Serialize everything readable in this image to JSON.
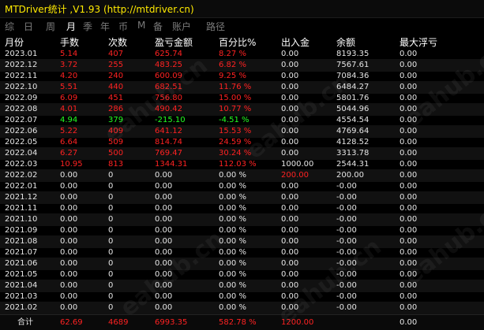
{
  "title": "MTDriver统计 ,V1.93 (http://mtdriver.cn)",
  "tabs": [
    {
      "label": "综",
      "active": false
    },
    {
      "label": "日",
      "active": false
    },
    {
      "label": "周",
      "active": false
    },
    {
      "label": "月",
      "active": true
    },
    {
      "label": "季",
      "active": false
    },
    {
      "label": "年",
      "active": false
    },
    {
      "label": "币",
      "active": false
    },
    {
      "label": "M",
      "active": false
    },
    {
      "label": "备",
      "active": false
    },
    {
      "label": "账户",
      "active": false
    },
    {
      "label": "路径",
      "active": false
    }
  ],
  "headers": [
    "月份",
    "手数",
    "次数",
    "盈亏金额",
    "百分比%",
    "出入金",
    "余额",
    "最大浮亏"
  ],
  "rows": [
    {
      "month": "2023.01",
      "lots": "5.14",
      "orders": "407",
      "profit": "625.74",
      "pct": "8.27 %",
      "dep": "0.00",
      "bal": "8193.35",
      "dd": "0.00",
      "color": "red"
    },
    {
      "month": "2022.12",
      "lots": "3.72",
      "orders": "255",
      "profit": "483.25",
      "pct": "6.82 %",
      "dep": "0.00",
      "bal": "7567.61",
      "dd": "0.00",
      "color": "red"
    },
    {
      "month": "2022.11",
      "lots": "4.20",
      "orders": "240",
      "profit": "600.09",
      "pct": "9.25 %",
      "dep": "0.00",
      "bal": "7084.36",
      "dd": "0.00",
      "color": "red"
    },
    {
      "month": "2022.10",
      "lots": "5.51",
      "orders": "440",
      "profit": "682.51",
      "pct": "11.76 %",
      "dep": "0.00",
      "bal": "6484.27",
      "dd": "0.00",
      "color": "red"
    },
    {
      "month": "2022.09",
      "lots": "6.09",
      "orders": "451",
      "profit": "756.80",
      "pct": "15.00 %",
      "dep": "0.00",
      "bal": "5801.76",
      "dd": "0.00",
      "color": "red"
    },
    {
      "month": "2022.08",
      "lots": "4.01",
      "orders": "286",
      "profit": "490.42",
      "pct": "10.77 %",
      "dep": "0.00",
      "bal": "5044.96",
      "dd": "0.00",
      "color": "red"
    },
    {
      "month": "2022.07",
      "lots": "4.94",
      "orders": "379",
      "profit": "-215.10",
      "pct": "-4.51 %",
      "dep": "0.00",
      "bal": "4554.54",
      "dd": "0.00",
      "color": "green"
    },
    {
      "month": "2022.06",
      "lots": "5.22",
      "orders": "409",
      "profit": "641.12",
      "pct": "15.53 %",
      "dep": "0.00",
      "bal": "4769.64",
      "dd": "0.00",
      "color": "red"
    },
    {
      "month": "2022.05",
      "lots": "6.64",
      "orders": "509",
      "profit": "814.74",
      "pct": "24.59 %",
      "dep": "0.00",
      "bal": "4128.52",
      "dd": "0.00",
      "color": "red"
    },
    {
      "month": "2022.04",
      "lots": "6.27",
      "orders": "500",
      "profit": "769.47",
      "pct": "30.24 %",
      "dep": "0.00",
      "bal": "3313.78",
      "dd": "0.00",
      "color": "red"
    },
    {
      "month": "2022.03",
      "lots": "10.95",
      "orders": "813",
      "profit": "1344.31",
      "pct": "112.03 %",
      "dep": "1000.00",
      "bal": "2544.31",
      "dd": "0.00",
      "color": "red"
    },
    {
      "month": "2022.02",
      "lots": "0.00",
      "orders": "0",
      "profit": "0.00",
      "pct": "0.00 %",
      "dep": "200.00",
      "bal": "200.00",
      "dd": "0.00",
      "color": "white",
      "depColor": "red"
    },
    {
      "month": "2022.01",
      "lots": "0.00",
      "orders": "0",
      "profit": "0.00",
      "pct": "0.00 %",
      "dep": "0.00",
      "bal": "-0.00",
      "dd": "0.00",
      "color": "white"
    },
    {
      "month": "2021.12",
      "lots": "0.00",
      "orders": "0",
      "profit": "0.00",
      "pct": "0.00 %",
      "dep": "0.00",
      "bal": "-0.00",
      "dd": "0.00",
      "color": "white"
    },
    {
      "month": "2021.11",
      "lots": "0.00",
      "orders": "0",
      "profit": "0.00",
      "pct": "0.00 %",
      "dep": "0.00",
      "bal": "-0.00",
      "dd": "0.00",
      "color": "white"
    },
    {
      "month": "2021.10",
      "lots": "0.00",
      "orders": "0",
      "profit": "0.00",
      "pct": "0.00 %",
      "dep": "0.00",
      "bal": "-0.00",
      "dd": "0.00",
      "color": "white"
    },
    {
      "month": "2021.09",
      "lots": "0.00",
      "orders": "0",
      "profit": "0.00",
      "pct": "0.00 %",
      "dep": "0.00",
      "bal": "-0.00",
      "dd": "0.00",
      "color": "white"
    },
    {
      "month": "2021.08",
      "lots": "0.00",
      "orders": "0",
      "profit": "0.00",
      "pct": "0.00 %",
      "dep": "0.00",
      "bal": "-0.00",
      "dd": "0.00",
      "color": "white"
    },
    {
      "month": "2021.07",
      "lots": "0.00",
      "orders": "0",
      "profit": "0.00",
      "pct": "0.00 %",
      "dep": "0.00",
      "bal": "-0.00",
      "dd": "0.00",
      "color": "white"
    },
    {
      "month": "2021.06",
      "lots": "0.00",
      "orders": "0",
      "profit": "0.00",
      "pct": "0.00 %",
      "dep": "0.00",
      "bal": "-0.00",
      "dd": "0.00",
      "color": "white"
    },
    {
      "month": "2021.05",
      "lots": "0.00",
      "orders": "0",
      "profit": "0.00",
      "pct": "0.00 %",
      "dep": "0.00",
      "bal": "-0.00",
      "dd": "0.00",
      "color": "white"
    },
    {
      "month": "2021.04",
      "lots": "0.00",
      "orders": "0",
      "profit": "0.00",
      "pct": "0.00 %",
      "dep": "0.00",
      "bal": "-0.00",
      "dd": "0.00",
      "color": "white"
    },
    {
      "month": "2021.03",
      "lots": "0.00",
      "orders": "0",
      "profit": "0.00",
      "pct": "0.00 %",
      "dep": "0.00",
      "bal": "-0.00",
      "dd": "0.00",
      "color": "white"
    },
    {
      "month": "2021.02",
      "lots": "0.00",
      "orders": "0",
      "profit": "0.00",
      "pct": "0.00 %",
      "dep": "0.00",
      "bal": "-0.00",
      "dd": "0.00",
      "color": "white"
    }
  ],
  "total": {
    "label": "合计",
    "lots": "62.69",
    "orders": "4689",
    "profit": "6993.35",
    "pct": "582.78 %",
    "dep": "1200.00",
    "bal": "",
    "dd": "0.00"
  },
  "watermark": "eahub.cn",
  "colors": {
    "title": "#ffea00",
    "positive": "#ff2222",
    "negative": "#22ff22",
    "text": "#e6e6e6",
    "muted": "#7a7a7a"
  }
}
